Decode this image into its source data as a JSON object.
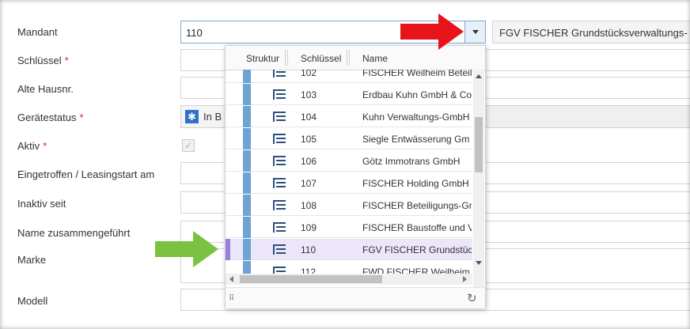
{
  "form": {
    "mandant_label": "Mandant",
    "mandant_value": "110",
    "mandant_name": "FGV FISCHER Grundstücksverwaltungs-",
    "schluessel_label": "Schlüssel",
    "alte_hausnr_label": "Alte Hausnr.",
    "geraetestatus_label": "Gerätestatus",
    "geraetestatus_value": "In B",
    "aktiv_label": "Aktiv",
    "eingetroffen_label": "Eingetroffen / Leasingstart am",
    "inaktiv_label": "Inaktiv seit",
    "name_zusammen_label": "Name zusammengeführt",
    "marke_label": "Marke",
    "modell_label": "Modell",
    "required_marker": "*",
    "checkbox_mark": "✓"
  },
  "dropdown": {
    "columns": [
      "Struktur",
      "Schlüssel",
      "Name"
    ],
    "rows": [
      {
        "key": "102",
        "name": "FISCHER Weilheim Beteil"
      },
      {
        "key": "103",
        "name": "Erdbau Kuhn GmbH & Co"
      },
      {
        "key": "104",
        "name": "Kuhn Verwaltungs-GmbH"
      },
      {
        "key": "105",
        "name": "Siegle Entwässerung Gm"
      },
      {
        "key": "106",
        "name": "Götz Immotrans GmbH"
      },
      {
        "key": "107",
        "name": "FISCHER Holding GmbH &"
      },
      {
        "key": "108",
        "name": "FISCHER Beteiligungs-Gr"
      },
      {
        "key": "109",
        "name": "FISCHER Baustoffe und V"
      },
      {
        "key": "110",
        "name": "FGV FISCHER Grundstück"
      },
      {
        "key": "112",
        "name": "FWD FISCHER Weilheim D"
      }
    ],
    "selected_key": "110",
    "footer_grip": "⠿",
    "refresh_glyph": "↻"
  },
  "colors": {
    "accent": "#2b73c6",
    "required": "#d9262b",
    "selected_row": "#ece6fb",
    "red_arrow": "#e8141b",
    "green_arrow": "#7cc242"
  },
  "icons": {
    "status": "star-icon",
    "tree": "tree-structure-icon",
    "refresh": "refresh-icon"
  }
}
